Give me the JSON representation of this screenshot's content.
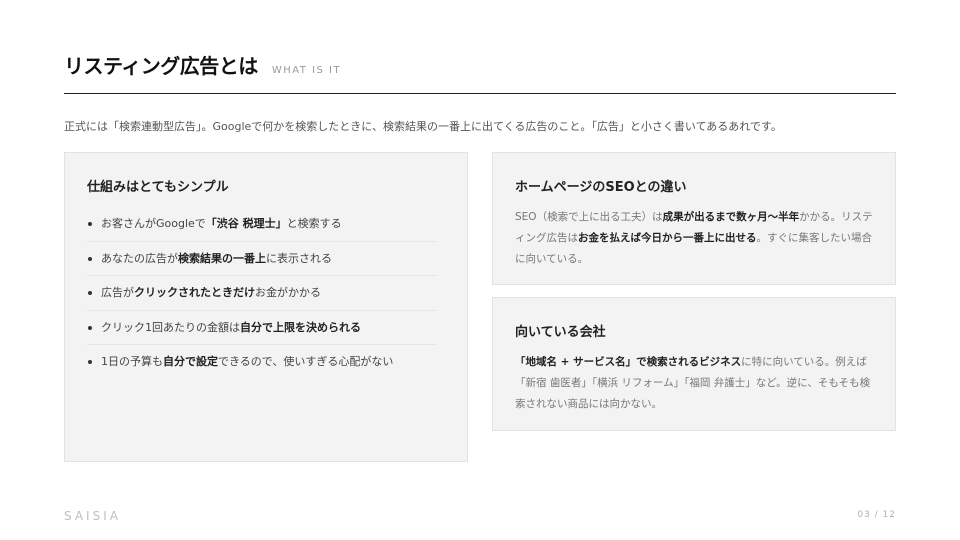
{
  "header": {
    "title": "リスティング広告とは",
    "subtitle": "WHAT IS IT"
  },
  "lead": "正式には「検索連動型広告」。Googleで何かを検索したときに、検索結果の一番上に出てくる広告のこと。「広告」と小さく書いてあるあれです。",
  "left_card": {
    "title": "仕組みはとてもシンプル",
    "items": [
      {
        "pre": "お客さんがGoogleで",
        "strong": "「渋谷 税理士」",
        "post": "と検索する"
      },
      {
        "pre": "あなたの広告が",
        "strong": "検索結果の一番上",
        "post": "に表示される"
      },
      {
        "pre": "広告が",
        "strong": "クリックされたときだけ",
        "post": "お金がかかる"
      },
      {
        "pre": "クリック1回あたりの金額は",
        "strong": "自分で上限を決められる",
        "post": ""
      },
      {
        "pre": "1日の予算も",
        "strong": "自分で設定",
        "post": "できるので、使いすぎる心配がない"
      }
    ]
  },
  "seo_card": {
    "title": "ホームページのSEOとの違い",
    "t1": "SEO（検索で上に出る工夫）は",
    "b1": "成果が出るまで数ヶ月〜半年",
    "t2": "かかる。リスティング広告は",
    "b2": "お金を払えば今日から一番上に出せる",
    "t3": "。すぐに集客したい場合に向いている。"
  },
  "fit_card": {
    "title": "向いている会社",
    "b1": "「地域名 + サービス名」で検索されるビジネス",
    "t1": "に特に向いている。例えば「新宿 歯医者」「横浜 リフォーム」「福岡 弁護士」など。逆に、そもそも検索されない商品には向かない。"
  },
  "footer": {
    "brand": "SAISIA",
    "page": "03 / 12"
  }
}
